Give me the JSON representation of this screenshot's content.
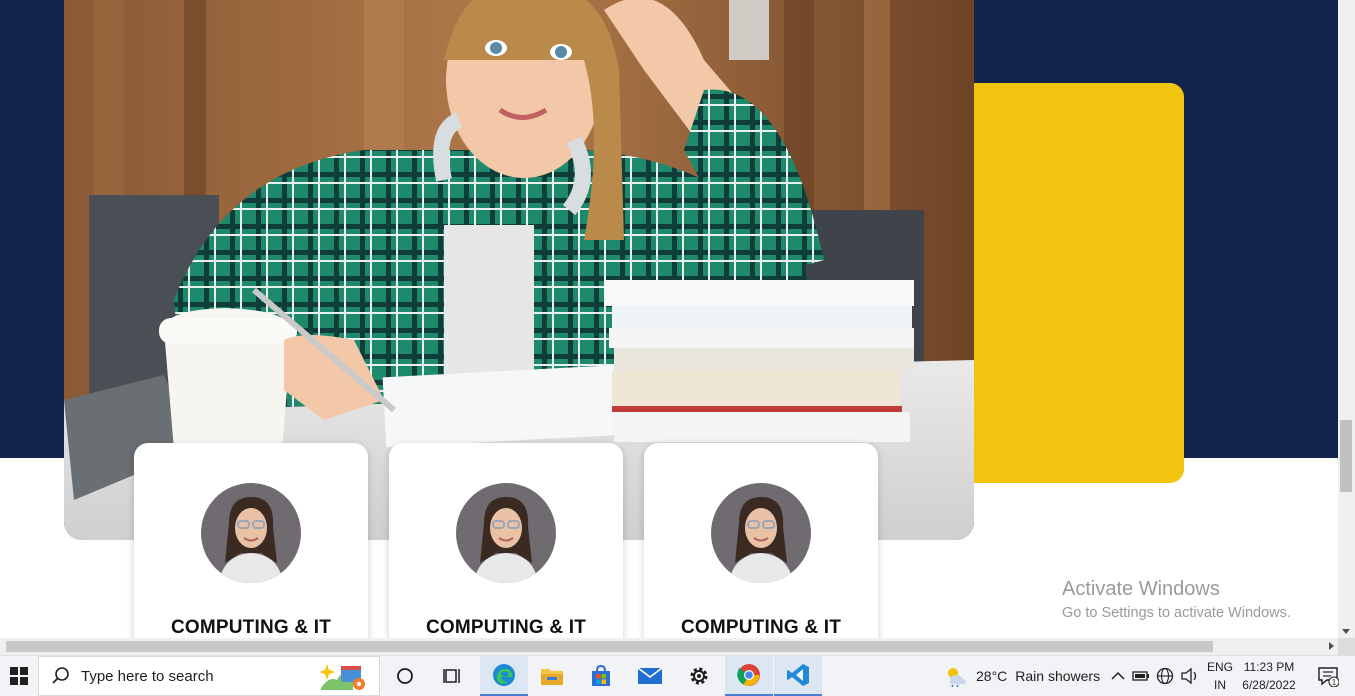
{
  "cards": [
    {
      "title": "COMPUTING & IT"
    },
    {
      "title": "COMPUTING & IT"
    },
    {
      "title": "COMPUTING & IT"
    }
  ],
  "watermark": {
    "title": "Activate Windows",
    "subtitle": "Go to Settings to activate Windows."
  },
  "taskbar": {
    "search_placeholder": "Type here to search",
    "pinned_apps": [
      "cortana-icon",
      "task-view-icon",
      "edge-icon",
      "file-explorer-icon",
      "store-icon",
      "mail-icon",
      "settings-icon",
      "chrome-icon",
      "vscode-icon"
    ],
    "weather": {
      "temp": "28°C",
      "condition": "Rain showers"
    },
    "language": {
      "line1": "ENG",
      "line2": "IN"
    },
    "clock": {
      "time": "11:23 PM",
      "date": "6/28/2022"
    },
    "notification_count": "1"
  },
  "colors": {
    "navy": "#12244b",
    "yellow": "#f1c40f",
    "accent": "#4a7ed1"
  }
}
